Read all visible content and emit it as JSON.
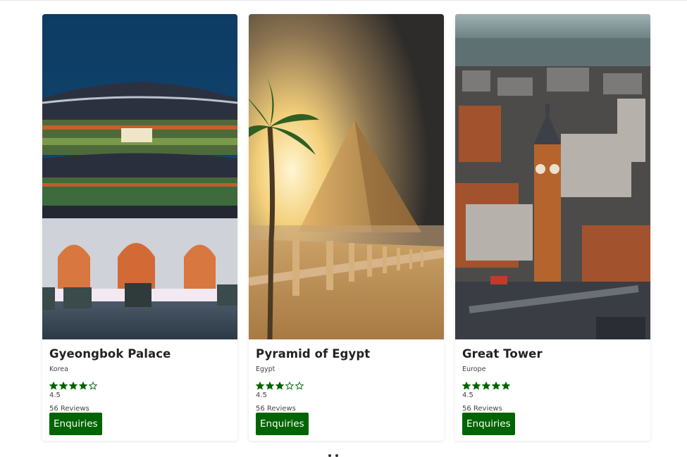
{
  "cards": [
    {
      "title": "Gyeongbok Palace",
      "location": "Korea",
      "rating_value": 4,
      "rating_text": "4.5",
      "reviews": "56 Reviews",
      "button_label": "Enquiries",
      "image_name": "gyeongbok-palace-photo"
    },
    {
      "title": "Pyramid of Egypt",
      "location": "Egypt",
      "rating_value": 3,
      "rating_text": "4.5",
      "reviews": "56 Reviews",
      "button_label": "Enquiries",
      "image_name": "pyramid-photo"
    },
    {
      "title": "Great Tower",
      "location": "Europe",
      "rating_value": 5,
      "rating_text": "4.5",
      "reviews": "56 Reviews",
      "button_label": "Enquiries",
      "image_name": "big-ben-photo"
    }
  ],
  "colors": {
    "accent": "#006400",
    "star": "#006400"
  },
  "icons": {
    "star_filled": "star-filled-icon",
    "star_empty": "star-empty-icon"
  }
}
